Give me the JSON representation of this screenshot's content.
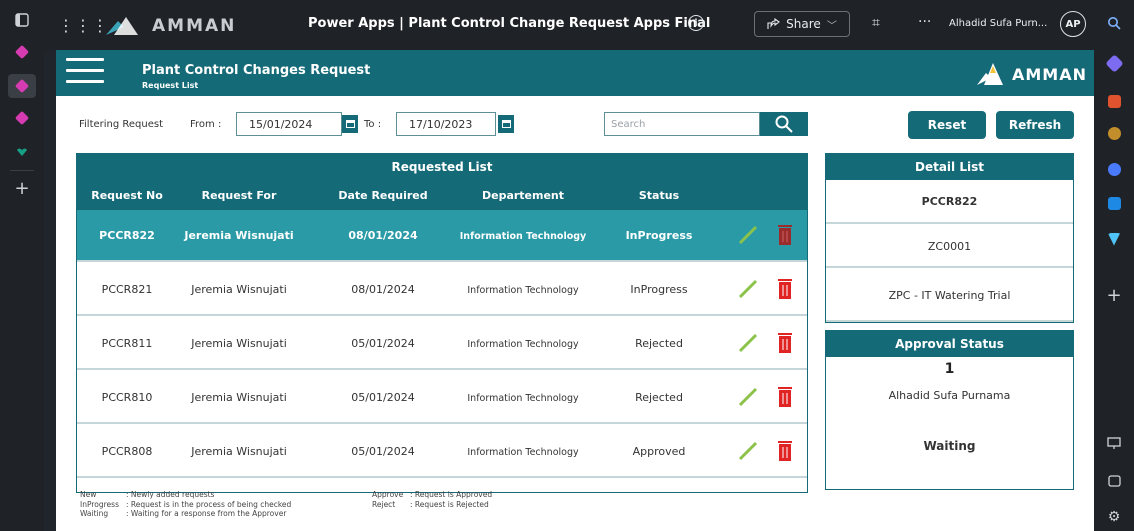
{
  "topbar": {
    "brand": "AMMAN",
    "title": "Power Apps  |  Plant Control Change Request Apps Final",
    "share_label": "Share",
    "user_name": "Alhadid Sufa Purn...",
    "user_initials": "AP"
  },
  "app": {
    "header_title": "Plant Control Changes Request",
    "header_subtitle": "Request List",
    "brand": "AMMAN"
  },
  "filter": {
    "label": "Filtering Request",
    "from_label": "From :",
    "from_value": "15/01/2024",
    "to_label": "To :",
    "to_value": "17/10/2023",
    "search_placeholder": "Search",
    "reset_label": "Reset",
    "refresh_label": "Refresh"
  },
  "requested_list": {
    "title": "Requested List",
    "columns": [
      "Request No",
      "Request For",
      "Date Required",
      "Departement",
      "Status"
    ],
    "rows": [
      {
        "no": "PCCR822",
        "for": "Jeremia Wisnujati",
        "date": "08/01/2024",
        "dept": "Information Technology",
        "status": "InProgress",
        "selected": true
      },
      {
        "no": "PCCR821",
        "for": "Jeremia Wisnujati",
        "date": "08/01/2024",
        "dept": "Information Technology",
        "status": "InProgress"
      },
      {
        "no": "PCCR811",
        "for": "Jeremia Wisnujati",
        "date": "05/01/2024",
        "dept": "Information Technology",
        "status": "Rejected"
      },
      {
        "no": "PCCR810",
        "for": "Jeremia Wisnujati",
        "date": "05/01/2024",
        "dept": "Information Technology",
        "status": "Rejected"
      },
      {
        "no": "PCCR808",
        "for": "Jeremia Wisnujati",
        "date": "05/01/2024",
        "dept": "Information Technology",
        "status": "Approved"
      }
    ]
  },
  "legend": {
    "left": [
      {
        "key": "New",
        "desc": ": Newly added requests"
      },
      {
        "key": "InProgress",
        "desc": ": Request is in the process of being checked"
      },
      {
        "key": "Waiting",
        "desc": ": Waiting for a response from the Approver"
      }
    ],
    "right": [
      {
        "key": "Approve",
        "desc": ": Request is Approved"
      },
      {
        "key": "Reject",
        "desc": ": Request is Rejected"
      }
    ]
  },
  "detail_list": {
    "title": "Detail List",
    "request_no": "PCCR822",
    "code": "ZC0001",
    "description": "ZPC - IT Watering Trial"
  },
  "approval_status": {
    "title": "Approval Status",
    "level": "1",
    "approver": "Alhadid Sufa Purnama",
    "status": "Waiting"
  },
  "colors": {
    "primary": "#156a77",
    "selected_row": "#2a9aa6",
    "edit_icon": "#8bc34a",
    "delete_icon": "#e02424"
  }
}
